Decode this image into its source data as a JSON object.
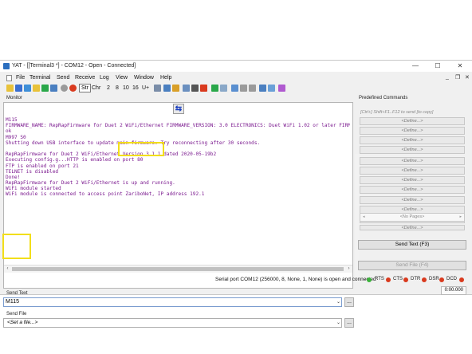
{
  "window": {
    "title": "YAT - [[Terminal3 *] - COM12 - Open - Connected]",
    "controls": {
      "minimize": "—",
      "maximize": "☐",
      "close": "✕"
    }
  },
  "menu": {
    "items": [
      "File",
      "Terminal",
      "Send",
      "Receive",
      "Log",
      "View",
      "Window",
      "Help"
    ],
    "right_controls": [
      "_",
      "❐",
      "✕"
    ]
  },
  "toolbar": {
    "format_labels": [
      "Str",
      "Chr",
      "2",
      "8",
      "10",
      "16",
      "U+"
    ]
  },
  "monitor": {
    "label": "Monitor",
    "swap_icon": "swap-arrows-icon",
    "lines": [
      "M115",
      "FIRMWARE_NAME: RepRapFirmware for Duet 2 WiFi/Ethernet FIRMWARE_VERSION: 3.0 ELECTRONICS: Duet WiFi 1.02 or later FIRMW",
      "ok",
      "M997 S0",
      "Shutting down USB interface to update main firmware. Try reconnecting after 30 seconds.",
      "",
      "RepRapFirmware for Duet 2 WiFi/Ethernet Version 3.1.1 dated 2020-05-19b2",
      "Executing config.g...HTTP is enabled on port 80",
      "FTP is enabled on port 21",
      "TELNET is disabled",
      "Done!",
      "RepRapFirmware for Duet 2 WiFi/Ethernet is up and running.",
      "WiFi module started",
      "WiFi module is connected to access point ZariboNet, IP address 192.1"
    ]
  },
  "send_text": {
    "label": "Send Text",
    "value": "M115",
    "button": "Send Text (F3)"
  },
  "send_file": {
    "label": "Send File",
    "placeholder": "<Set a file...>",
    "button": "Send File (F4)"
  },
  "browse_label": "...",
  "predefined": {
    "label": "Predefined Commands",
    "hint": "[Ctrl+] Shift+F1..F12 to send [to copy]",
    "buttons": [
      "<Define...>",
      "<Define...>",
      "<Define...>",
      "<Define...>",
      "<Define...>",
      "<Define...>",
      "<Define...>",
      "<Define...>",
      "<Define...>",
      "<Define...>",
      "<Define...>",
      "<Define...>"
    ],
    "pages": "<No Pages>"
  },
  "status": {
    "text": "Serial port COM12 (256000, 8, None, 1, None) is open and connected",
    "indicators": [
      {
        "label": "RTS",
        "color": "#d93a1e"
      },
      {
        "label": "CTS",
        "color": "#d93a1e"
      },
      {
        "label": "DTR",
        "color": "#d93a1e"
      },
      {
        "label": "DSR",
        "color": "#d93a1e"
      },
      {
        "label": "DCD",
        "color": "#d93a1e"
      }
    ],
    "connection_color": "#3bb33b",
    "timer": "0:00.000"
  },
  "colors": {
    "terminal_text": "#7b1a8f",
    "highlight": "#f2de1a"
  }
}
